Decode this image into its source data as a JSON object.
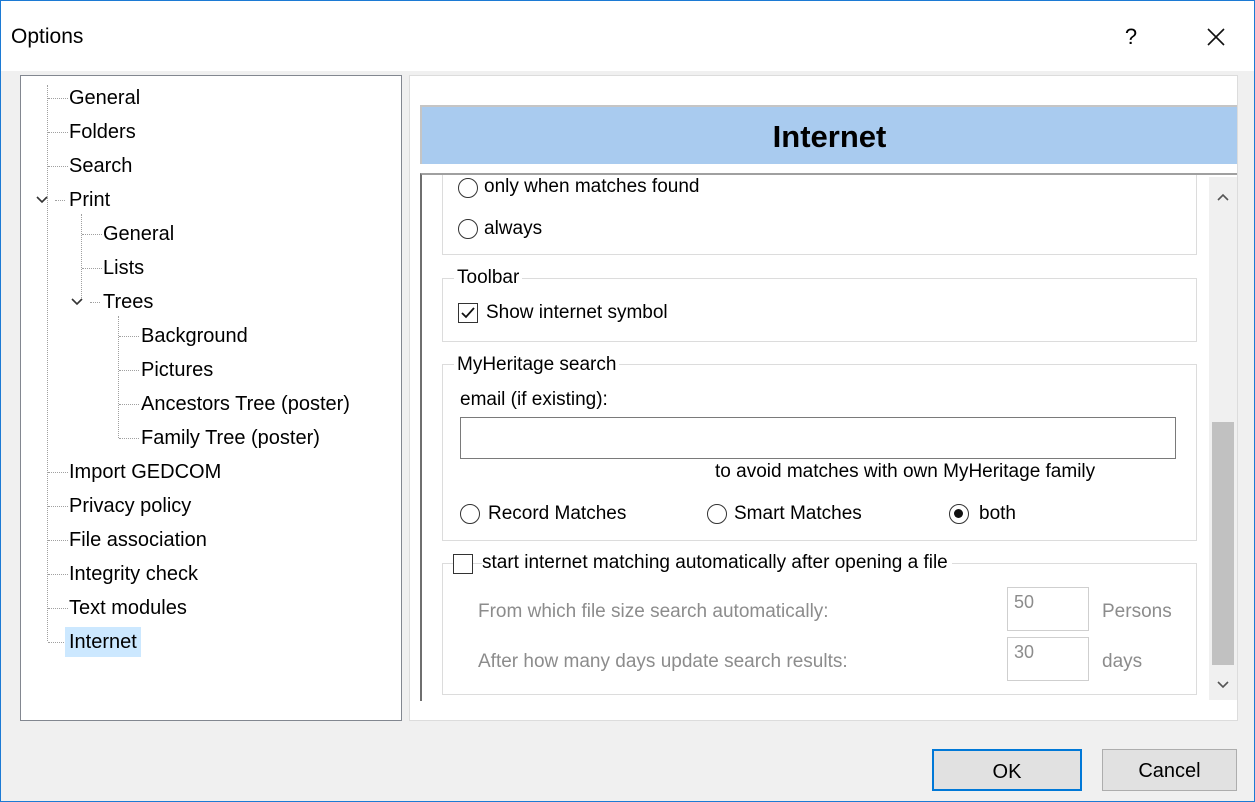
{
  "window": {
    "title": "Options",
    "help_label": "?",
    "close_icon": "close-icon"
  },
  "tree": {
    "items": [
      {
        "label": "General"
      },
      {
        "label": "Folders"
      },
      {
        "label": "Search"
      },
      {
        "label": "Print"
      },
      {
        "label": "General"
      },
      {
        "label": "Lists"
      },
      {
        "label": "Trees"
      },
      {
        "label": "Background"
      },
      {
        "label": "Pictures"
      },
      {
        "label": "Ancestors Tree (poster)"
      },
      {
        "label": "Family Tree (poster)"
      },
      {
        "label": "Import GEDCOM"
      },
      {
        "label": "Privacy policy"
      },
      {
        "label": "File association"
      },
      {
        "label": "Integrity check"
      },
      {
        "label": "Text modules"
      },
      {
        "label": "Internet"
      }
    ],
    "selected": "Internet"
  },
  "page": {
    "header": "Internet"
  },
  "partial_group": {
    "option_only_label": "only when matches found",
    "option_always_label": "always"
  },
  "toolbar_group": {
    "title": "Toolbar",
    "show_symbol_label": "Show internet symbol",
    "show_symbol_checked": true
  },
  "myheritage_group": {
    "title": "MyHeritage search",
    "email_label": "email (if existing):",
    "email_value": "",
    "email_hint": "to avoid matches with own MyHeritage family",
    "radio_record": "Record Matches",
    "radio_smart": "Smart Matches",
    "radio_both": "both",
    "selected": "both"
  },
  "auto_group": {
    "title": "start internet matching automatically after opening a file",
    "checked": false,
    "filesize_label": "From which file size search automatically:",
    "filesize_value": "50",
    "filesize_unit": "Persons",
    "days_label": "After how many days update search results:",
    "days_value": "30",
    "days_unit": "days"
  },
  "buttons": {
    "ok": "OK",
    "cancel": "Cancel"
  }
}
